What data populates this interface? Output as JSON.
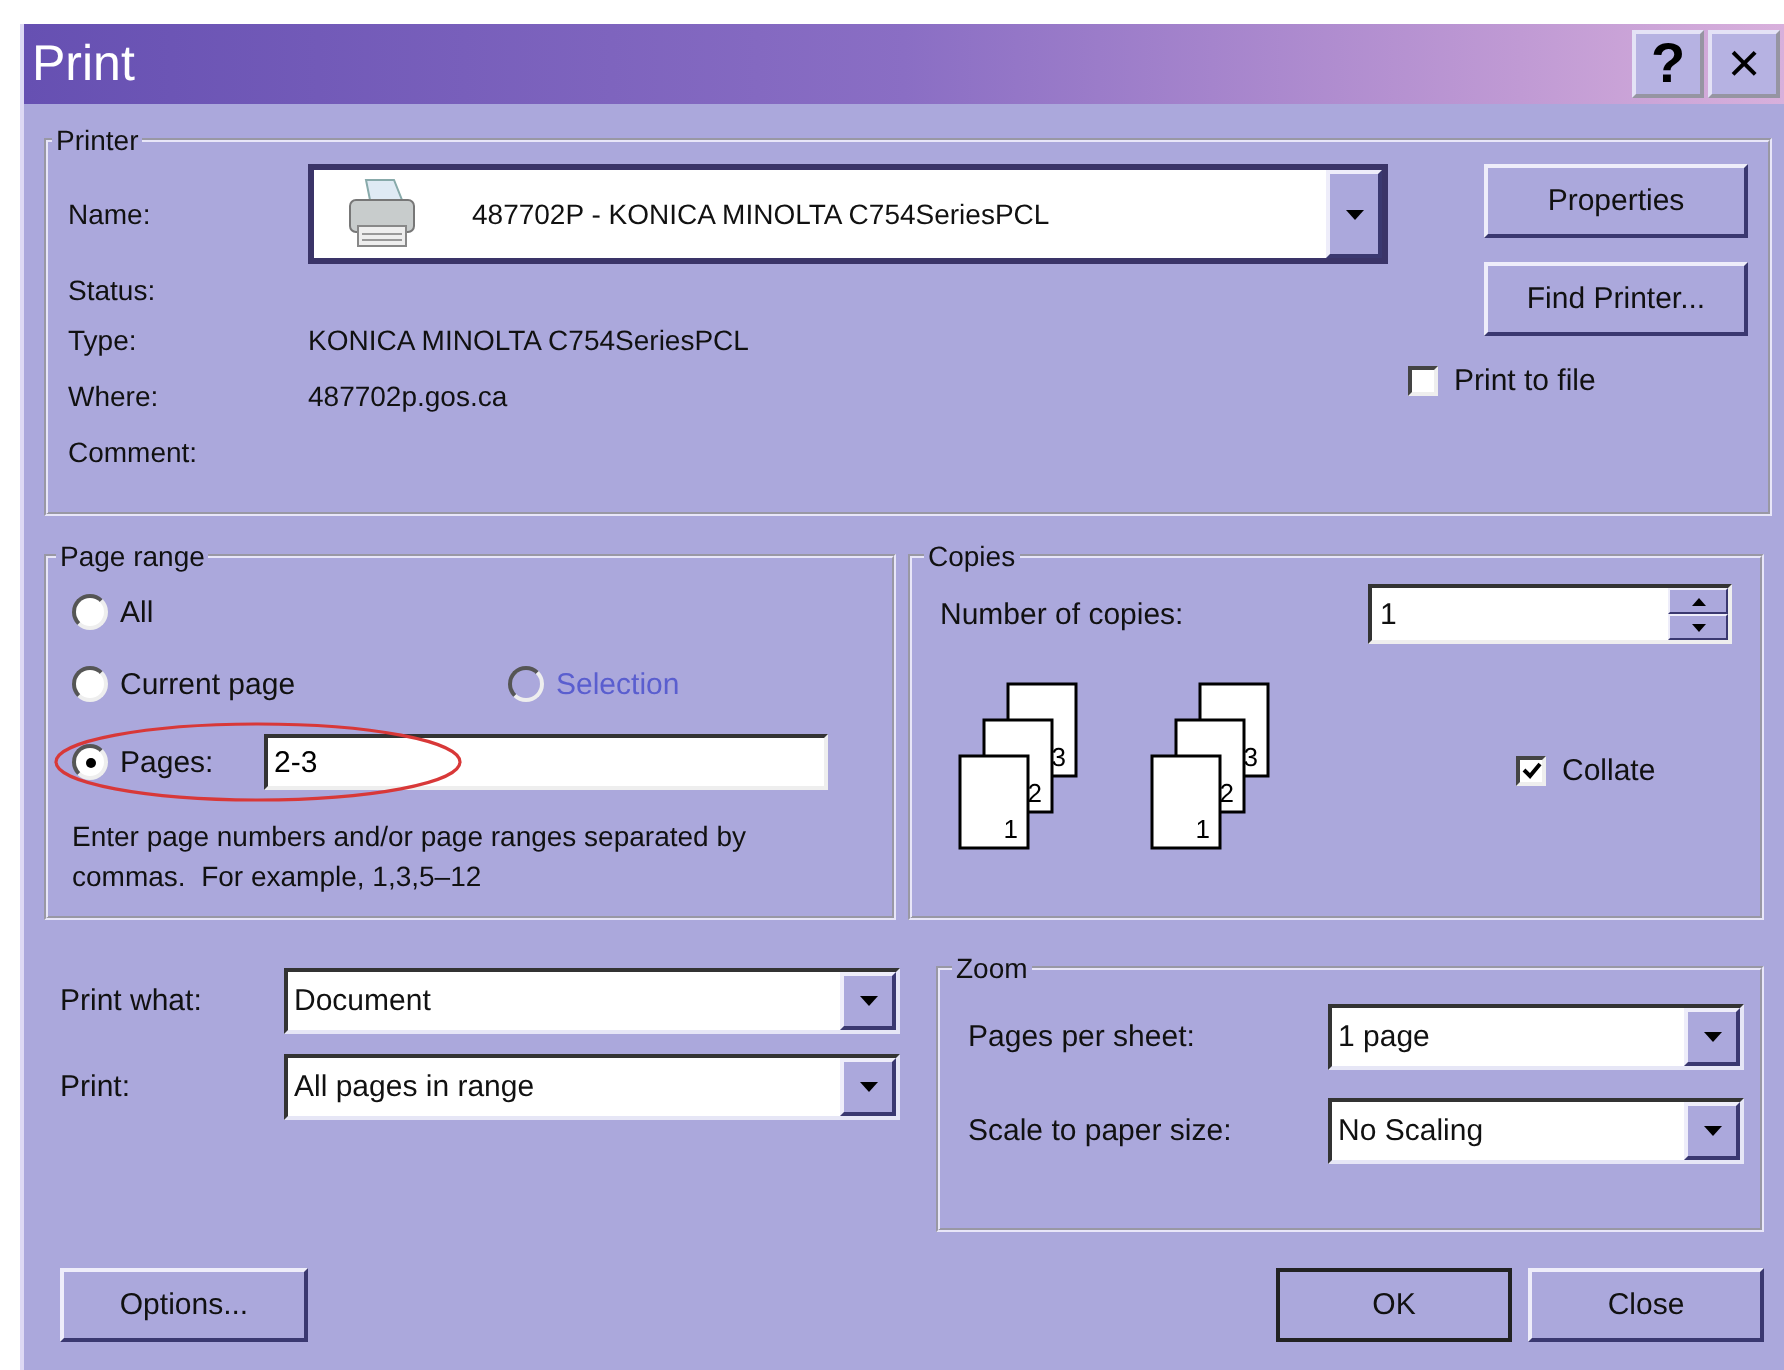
{
  "window": {
    "title": "Print",
    "buttons": [
      {
        "kind": "help",
        "label": "?"
      },
      {
        "kind": "close",
        "label": "×"
      }
    ]
  },
  "printer": {
    "group_label": "Printer",
    "name": {
      "label": "Name:",
      "value": "487702P - KONICA MINOLTA C754SeriesPCL"
    },
    "info": [
      {
        "label": "Status:"
      },
      {
        "label": "Type:",
        "value": "KONICA MINOLTA C754SeriesPCL"
      },
      {
        "label": "Where:",
        "value": "487702p.gos.ca"
      },
      {
        "label": "Comment:"
      }
    ],
    "buttons": [
      "Properties",
      "Find Printer..."
    ],
    "print_to_file": {
      "label": "Print to file",
      "checked": false
    }
  },
  "page_range": {
    "group_label": "Page range",
    "options": [
      {
        "label": "All",
        "selected": false,
        "disabled": false
      },
      {
        "label": "Current page",
        "selected": false,
        "disabled": false
      },
      {
        "label": "Selection",
        "selected": false,
        "disabled": true
      },
      {
        "label": "Pages:",
        "selected": true,
        "disabled": false,
        "value": "2-3",
        "circled": true
      }
    ],
    "hint": "Enter page numbers and/or page ranges separated by commas.  For example, 1,3,5–12"
  },
  "copies": {
    "group_label": "Copies",
    "label": "Number of copies:",
    "value": "1",
    "illustrations": [
      {
        "pages": [
          "1",
          "2",
          "3"
        ]
      },
      {
        "pages": [
          "1",
          "2",
          "3"
        ]
      }
    ],
    "collate": {
      "label": "Collate",
      "checked": true
    }
  },
  "print_options": [
    {
      "label": "Print what:",
      "value": "Document"
    },
    {
      "label": "Print:",
      "value": "All pages in range"
    }
  ],
  "zoom": {
    "group_label": "Zoom",
    "fields": [
      {
        "label": "Pages per sheet:",
        "value": "1 page"
      },
      {
        "label": "Scale to paper size:",
        "value": "No Scaling"
      }
    ]
  },
  "buttons": {
    "options": "Options...",
    "ok": "OK",
    "close": "Close"
  }
}
